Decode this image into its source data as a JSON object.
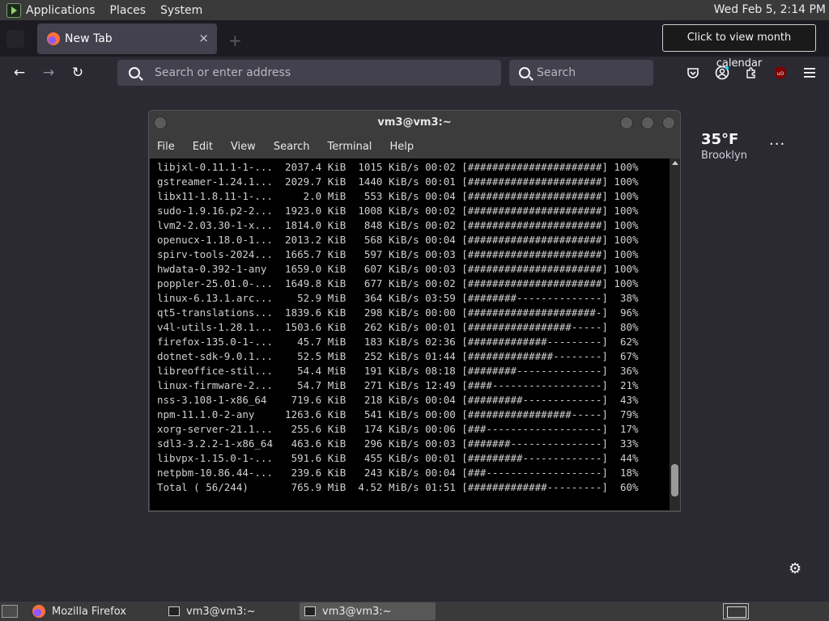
{
  "top_panel": {
    "menus": [
      "Applications",
      "Places",
      "System"
    ],
    "clock": "Wed Feb  5, 2:14 PM"
  },
  "tooltip": "Click to view month calendar",
  "browser": {
    "tab_title": "New Tab",
    "tab_close": "×",
    "new_tab": "+",
    "url_placeholder": "Search or enter address",
    "search_placeholder": "Search",
    "icons": [
      "back-icon",
      "forward-icon",
      "reload-icon",
      "pocket-icon",
      "account-icon",
      "extensions-icon",
      "ublock-icon",
      "menu-icon"
    ]
  },
  "newtab": {
    "temperature": "35°F",
    "location": "Brooklyn",
    "menu": "···"
  },
  "terminal": {
    "title": "vm3@vm3:~",
    "menu": [
      "File",
      "Edit",
      "View",
      "Search",
      "Terminal",
      "Help"
    ],
    "lines": [
      "libjxl-0.11.1-1-...  2037.4 KiB  1015 KiB/s 00:02 [######################] 100%",
      "gstreamer-1.24.1...  2029.7 KiB  1440 KiB/s 00:01 [######################] 100%",
      "libx11-1.8.11-1-...     2.0 MiB   553 KiB/s 00:04 [######################] 100%",
      "sudo-1.9.16.p2-2...  1923.0 KiB  1008 KiB/s 00:02 [######################] 100%",
      "lvm2-2.03.30-1-x...  1814.0 KiB   848 KiB/s 00:02 [######################] 100%",
      "openucx-1.18.0-1...  2013.2 KiB   568 KiB/s 00:04 [######################] 100%",
      "spirv-tools-2024...  1665.7 KiB   597 KiB/s 00:03 [######################] 100%",
      "hwdata-0.392-1-any   1659.0 KiB   607 KiB/s 00:03 [######################] 100%",
      "poppler-25.01.0-...  1649.8 KiB   677 KiB/s 00:02 [######################] 100%",
      "linux-6.13.1.arc...    52.9 MiB   364 KiB/s 03:59 [########--------------]  38%",
      "qt5-translations...  1839.6 KiB   298 KiB/s 00:00 [#####################-]  96%",
      "v4l-utils-1.28.1...  1503.6 KiB   262 KiB/s 00:01 [#################-----]  80%",
      "firefox-135.0-1-...    45.7 MiB   183 KiB/s 02:36 [#############---------]  62%",
      "dotnet-sdk-9.0.1...    52.5 MiB   252 KiB/s 01:44 [##############--------]  67%",
      "libreoffice-stil...    54.4 MiB   191 KiB/s 08:18 [########--------------]  36%",
      "linux-firmware-2...    54.7 MiB   271 KiB/s 12:49 [####------------------]  21%",
      "nss-3.108-1-x86_64    719.6 KiB   218 KiB/s 00:04 [#########-------------]  43%",
      "npm-11.1.0-2-any     1263.6 KiB   541 KiB/s 00:00 [#################-----]  79%",
      "xorg-server-21.1...   255.6 KiB   174 KiB/s 00:06 [###-------------------]  17%",
      "sdl3-3.2.2-1-x86_64   463.6 KiB   296 KiB/s 00:03 [#######---------------]  33%",
      "libvpx-1.15.0-1-...   591.6 KiB   455 KiB/s 00:01 [#########-------------]  44%",
      "netpbm-10.86.44-...   239.6 KiB   243 KiB/s 00:04 [###-------------------]  18%",
      "Total ( 56/244)       765.9 MiB  4.52 MiB/s 01:51 [#############---------]  60%"
    ]
  },
  "taskbar": {
    "tasks": [
      "Mozilla Firefox",
      "vm3@vm3:~",
      "vm3@vm3:~"
    ]
  }
}
